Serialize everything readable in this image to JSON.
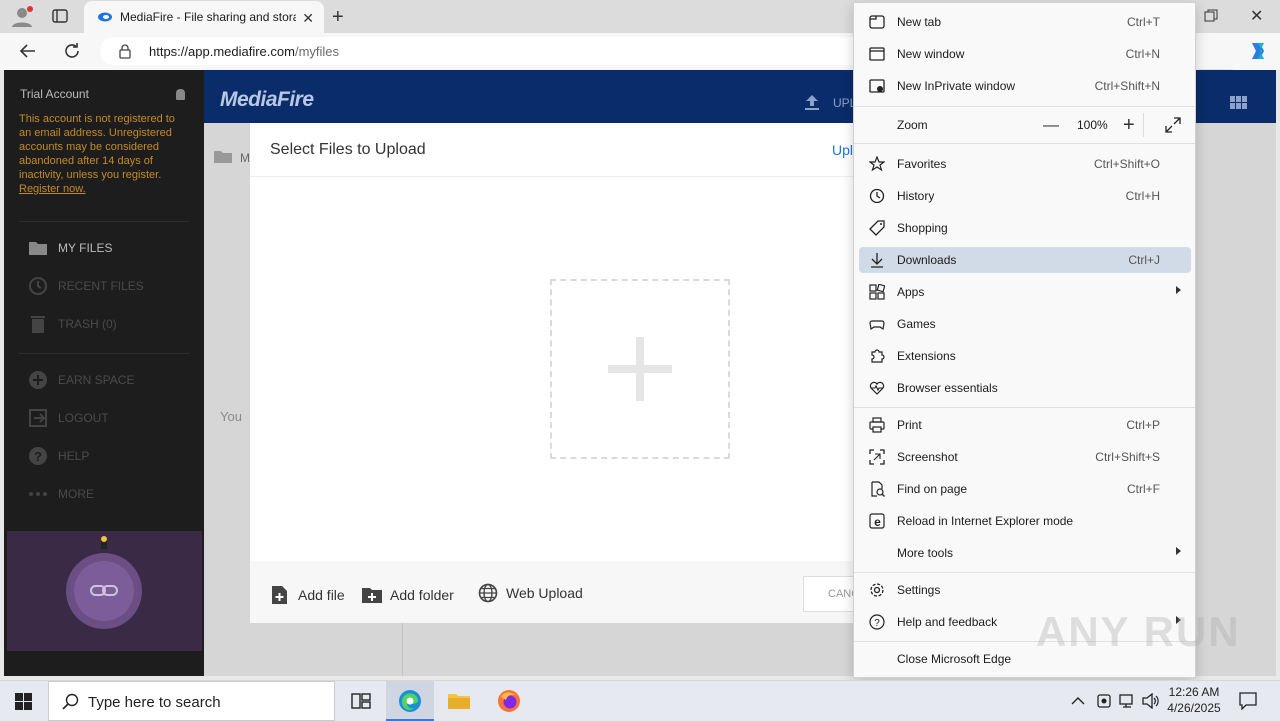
{
  "browser": {
    "tab_title": "MediaFire - File sharing and stora",
    "url_domain": "https://app.mediafire.com",
    "url_path": "/myfiles"
  },
  "sidebar": {
    "account_label": "Trial Account",
    "notice": "This account is not registered to an email address. Unregistered accounts may be considered abandoned after 14 days of inactivity, unless you register.",
    "register_link": "Register now.",
    "items": [
      {
        "label": "MY FILES",
        "icon": "folder-icon"
      },
      {
        "label": "RECENT FILES",
        "icon": "clock-icon"
      },
      {
        "label": "TRASH (0)",
        "icon": "trash-icon"
      },
      {
        "label": "EARN SPACE",
        "icon": "plus-circle-icon"
      },
      {
        "label": "LOGOUT",
        "icon": "logout-icon"
      },
      {
        "label": "HELP",
        "icon": "help-icon"
      },
      {
        "label": "MORE",
        "icon": "more-icon"
      }
    ]
  },
  "header": {
    "logo": "MediaFire",
    "upload_label": "UPL"
  },
  "content": {
    "breadcrumb": "My",
    "empty_text": "You"
  },
  "dialog": {
    "title": "Select Files to Upload",
    "upload_link": "Upl",
    "add_file": "Add file",
    "add_folder": "Add folder",
    "web_upload": "Web Upload",
    "cancel": "CANC"
  },
  "menu": {
    "items": [
      {
        "label": "New tab",
        "shortcut": "Ctrl+T",
        "icon": "new-tab-icon"
      },
      {
        "label": "New window",
        "shortcut": "Ctrl+N",
        "icon": "new-window-icon"
      },
      {
        "label": "New InPrivate window",
        "shortcut": "Ctrl+Shift+N",
        "icon": "inprivate-icon"
      },
      {
        "label": "Favorites",
        "shortcut": "Ctrl+Shift+O",
        "icon": "star-icon"
      },
      {
        "label": "History",
        "shortcut": "Ctrl+H",
        "icon": "history-icon"
      },
      {
        "label": "Shopping",
        "shortcut": "",
        "icon": "tag-icon"
      },
      {
        "label": "Downloads",
        "shortcut": "Ctrl+J",
        "icon": "download-icon"
      },
      {
        "label": "Apps",
        "shortcut": "",
        "icon": "apps-icon"
      },
      {
        "label": "Games",
        "shortcut": "",
        "icon": "games-icon"
      },
      {
        "label": "Extensions",
        "shortcut": "",
        "icon": "extensions-icon"
      },
      {
        "label": "Browser essentials",
        "shortcut": "",
        "icon": "heart-pulse-icon"
      },
      {
        "label": "Print",
        "shortcut": "Ctrl+P",
        "icon": "print-icon"
      },
      {
        "label": "Screenshot",
        "shortcut": "Ctrl+Shift+S",
        "icon": "screenshot-icon"
      },
      {
        "label": "Find on page",
        "shortcut": "Ctrl+F",
        "icon": "find-icon"
      },
      {
        "label": "Reload in Internet Explorer mode",
        "shortcut": "",
        "icon": "ie-icon"
      },
      {
        "label": "More tools",
        "shortcut": "",
        "icon": ""
      },
      {
        "label": "Settings",
        "shortcut": "",
        "icon": "gear-icon"
      },
      {
        "label": "Help and feedback",
        "shortcut": "",
        "icon": "help-icon"
      },
      {
        "label": "Close Microsoft Edge",
        "shortcut": "",
        "icon": ""
      }
    ],
    "zoom_label": "Zoom",
    "zoom_value": "100%"
  },
  "taskbar": {
    "search_placeholder": "Type here to search",
    "time": "12:26 AM",
    "date": "4/26/2025"
  },
  "watermark": "ANY RUN"
}
